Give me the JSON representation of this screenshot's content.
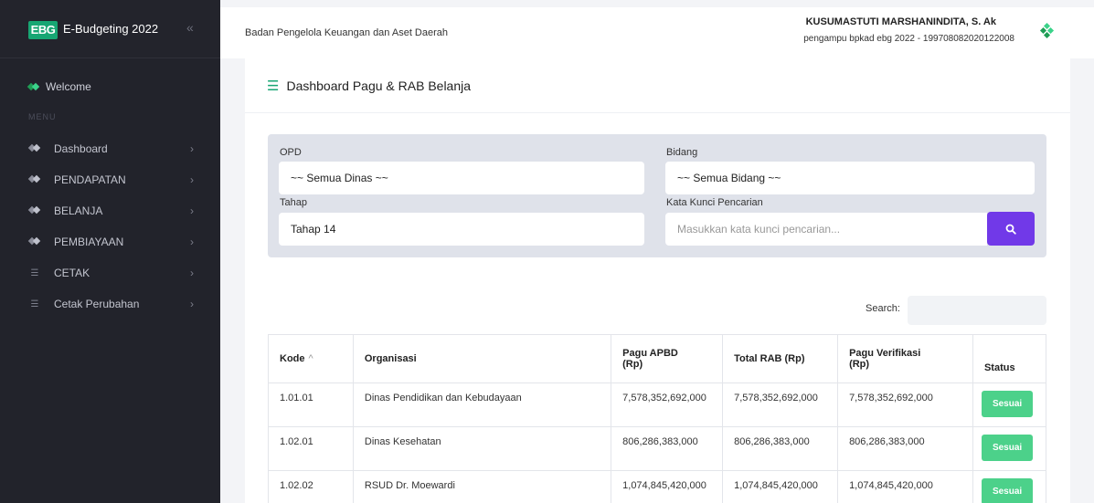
{
  "sidebar": {
    "brand_logo": "EBG",
    "brand_title": "E-Budgeting 2022",
    "collapse_icon": "«",
    "welcome": "Welcome",
    "menu_title": "MENU",
    "items": [
      {
        "label": "Dashboard",
        "icon": "diamond-icon"
      },
      {
        "label": "PENDAPATAN",
        "icon": "diamond-icon"
      },
      {
        "label": "BELANJA",
        "icon": "diamond-icon"
      },
      {
        "label": "PEMBIAYAAN",
        "icon": "diamond-icon"
      },
      {
        "label": "CETAK",
        "icon": "list-icon"
      },
      {
        "label": "Cetak Perubahan",
        "icon": "list-icon"
      }
    ]
  },
  "topbar": {
    "org_name": "Badan Pengelola Keuangan dan Aset Daerah",
    "user_name": "KUSUMASTUTI MARSHANINDITA, S. Ak",
    "user_role": "pengampu bpkad ebg 2022 - 199708082020122008"
  },
  "panel": {
    "title": "Dashboard Pagu & RAB Belanja"
  },
  "filters": {
    "opd_label": "OPD",
    "opd_value": "~~ Semua Dinas ~~",
    "bidang_label": "Bidang",
    "bidang_value": "~~ Semua Bidang ~~",
    "tahap_label": "Tahap",
    "tahap_value": "Tahap 14",
    "keyword_label": "Kata Kunci Pencarian",
    "keyword_placeholder": "Masukkan kata kunci pencarian..."
  },
  "datatable": {
    "search_label": "Search:",
    "headers": {
      "kode": "Kode",
      "organisasi": "Organisasi",
      "pagu_apbd": "Pagu APBD (Rp)",
      "total_rab": "Total RAB (Rp)",
      "pagu_verifikasi": "Pagu Verifikasi (Rp)",
      "status": "Status"
    },
    "rows": [
      {
        "kode": "1.01.01",
        "organisasi": "Dinas Pendidikan dan Kebudayaan",
        "pagu_apbd": "7,578,352,692,000",
        "total_rab": "7,578,352,692,000",
        "pagu_verifikasi": "7,578,352,692,000",
        "status": "Sesuai"
      },
      {
        "kode": "1.02.01",
        "organisasi": "Dinas Kesehatan",
        "pagu_apbd": "806,286,383,000",
        "total_rab": "806,286,383,000",
        "pagu_verifikasi": "806,286,383,000",
        "status": "Sesuai"
      },
      {
        "kode": "1.02.02",
        "organisasi": "RSUD Dr. Moewardi",
        "pagu_apbd": "1,074,845,420,000",
        "total_rab": "1,074,845,420,000",
        "pagu_verifikasi": "1,074,845,420,000",
        "status": "Sesuai"
      }
    ]
  }
}
